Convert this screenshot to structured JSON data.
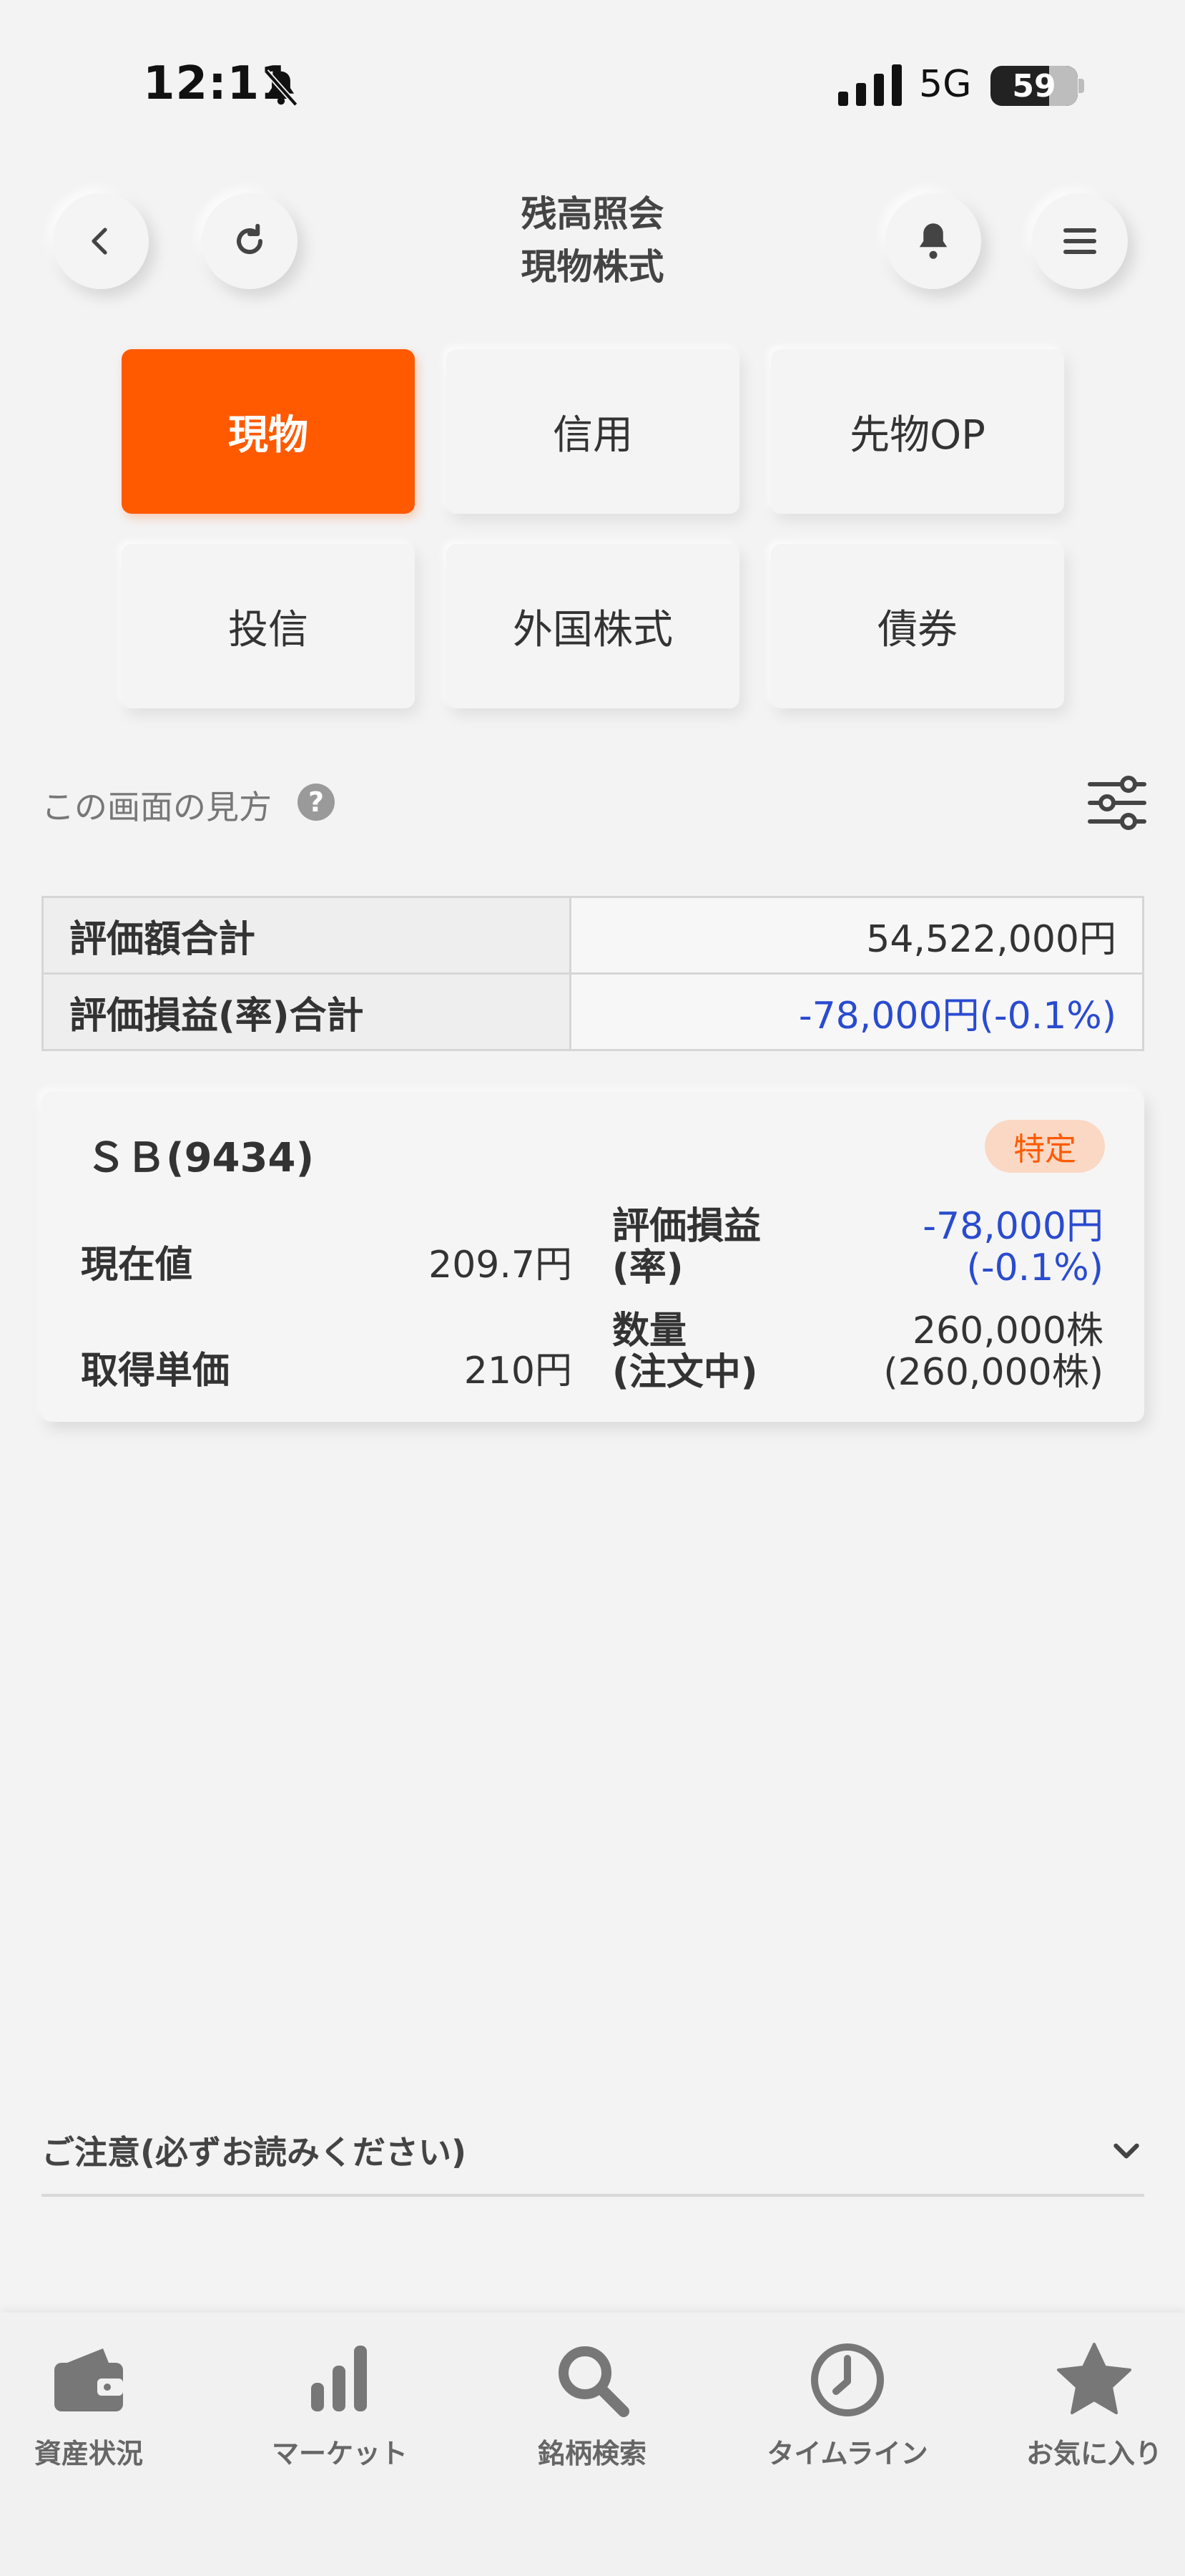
{
  "status_bar": {
    "time": "12:11",
    "network": "5G",
    "battery": "59"
  },
  "header": {
    "title_line1": "残高照会",
    "title_line2": "現物株式"
  },
  "tabs": [
    {
      "label": "現物",
      "active": true
    },
    {
      "label": "信用",
      "active": false
    },
    {
      "label": "先物OP",
      "active": false
    },
    {
      "label": "投信",
      "active": false
    },
    {
      "label": "外国株式",
      "active": false
    },
    {
      "label": "債券",
      "active": false
    }
  ],
  "help": {
    "label": "この画面の見方",
    "icon": "?"
  },
  "summary": [
    {
      "label": "評価額合計",
      "value": "54,522,000円"
    },
    {
      "label": "評価損益(率)合計",
      "value": "-78,000円(-0.1%)"
    }
  ],
  "holding": {
    "name": "ＳＢ(9434)",
    "badge": "特定",
    "current_price_label": "現在値",
    "current_price": "209.7円",
    "pl_label_1": "評価損益",
    "pl_label_2": "(率)",
    "pl_value_1": "-78,000円",
    "pl_value_2": "(-0.1%)",
    "cost_label": "取得単価",
    "cost": "210円",
    "qty_label_1": "数量",
    "qty_label_2": "(注文中)",
    "qty_value_1": "260,000株",
    "qty_value_2": "(260,000株)"
  },
  "notice": {
    "label": "ご注意(必ずお読みください)"
  },
  "bottom_nav": [
    {
      "label": "資産状況",
      "icon": "wallet-icon"
    },
    {
      "label": "マーケット",
      "icon": "bar-chart-icon"
    },
    {
      "label": "銘柄検索",
      "icon": "search-icon"
    },
    {
      "label": "タイムライン",
      "icon": "clock-icon"
    },
    {
      "label": "お気に入り",
      "icon": "star-icon"
    }
  ],
  "colors": {
    "accent": "#ff5a00",
    "negative": "#2a4bd0",
    "badge_bg": "#fbd8c4"
  }
}
